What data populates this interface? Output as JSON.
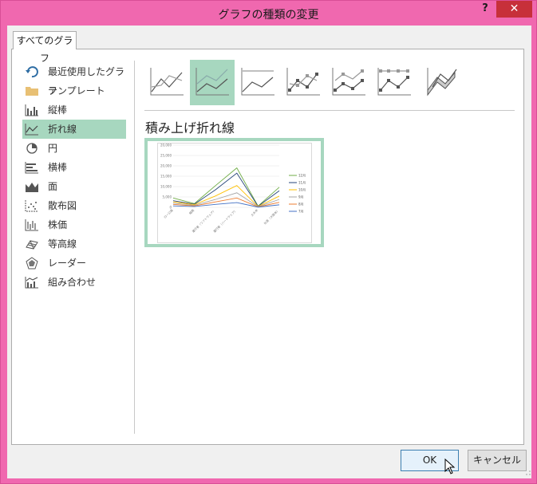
{
  "window": {
    "title": "グラフの種類の変更",
    "help_label": "?",
    "close_label": "✕"
  },
  "tabs": [
    {
      "label": "すべてのグラフ",
      "selected": true
    }
  ],
  "sidebar": {
    "items": [
      {
        "label": "最近使用したグラフ",
        "icon": "recent-icon"
      },
      {
        "label": "テンプレート",
        "icon": "folder-icon"
      },
      {
        "label": "縦棒",
        "icon": "column-chart-icon"
      },
      {
        "label": "折れ線",
        "icon": "line-chart-icon",
        "selected": true
      },
      {
        "label": "円",
        "icon": "pie-chart-icon"
      },
      {
        "label": "横棒",
        "icon": "bar-chart-icon"
      },
      {
        "label": "面",
        "icon": "area-chart-icon"
      },
      {
        "label": "散布図",
        "icon": "scatter-chart-icon"
      },
      {
        "label": "株価",
        "icon": "stock-chart-icon"
      },
      {
        "label": "等高線",
        "icon": "surface-chart-icon"
      },
      {
        "label": "レーダー",
        "icon": "radar-chart-icon"
      },
      {
        "label": "組み合わせ",
        "icon": "combo-chart-icon"
      }
    ]
  },
  "subtypes": [
    {
      "icon": "line-icon",
      "selected": false
    },
    {
      "icon": "stacked-line-icon",
      "selected": true
    },
    {
      "icon": "percent-stacked-line-icon",
      "selected": false
    },
    {
      "icon": "line-with-markers-icon",
      "selected": false
    },
    {
      "icon": "stacked-line-with-markers-icon",
      "selected": false
    },
    {
      "icon": "percent-stacked-line-with-markers-icon",
      "selected": false
    },
    {
      "icon": "3d-line-icon",
      "selected": false
    }
  ],
  "preview": {
    "title": "積み上げ折れ線",
    "chart_data": {
      "type": "line",
      "categories": [
        "ロー公路",
        "縮路",
        "運行者（ソフトウェア）",
        "運行者（ハードウェア）",
        "土木本",
        "社員（大阪本）"
      ],
      "ytick_labels": [
        "20,000",
        "25,000",
        "20,000",
        "15,000",
        "10,000",
        "5,000",
        "0"
      ],
      "ylim": [
        0,
        30000
      ],
      "series": [
        {
          "name": "12月",
          "color": "#70ad47",
          "values": [
            4500,
            1800,
            10500,
            19000,
            600,
            9700
          ]
        },
        {
          "name": "11月",
          "color": "#264478",
          "values": [
            3200,
            1500,
            8500,
            16500,
            500,
            8000
          ]
        },
        {
          "name": "10月",
          "color": "#ffc000",
          "values": [
            2600,
            1300,
            5500,
            10500,
            400,
            5400
          ]
        },
        {
          "name": "9月",
          "color": "#a5a5a5",
          "values": [
            2000,
            1000,
            3800,
            7000,
            300,
            3800
          ]
        },
        {
          "name": "8月",
          "color": "#ed7d31",
          "values": [
            1400,
            700,
            2600,
            4500,
            200,
            2400
          ]
        },
        {
          "name": "7月",
          "color": "#4472c4",
          "values": [
            700,
            400,
            1400,
            2300,
            100,
            1200
          ]
        }
      ],
      "legend_position": "right"
    }
  },
  "buttons": {
    "ok": "OK",
    "cancel": "キャンセル"
  },
  "colors": {
    "frame": "#f068af",
    "selection": "#a7d7bf",
    "close": "#c7303a"
  }
}
